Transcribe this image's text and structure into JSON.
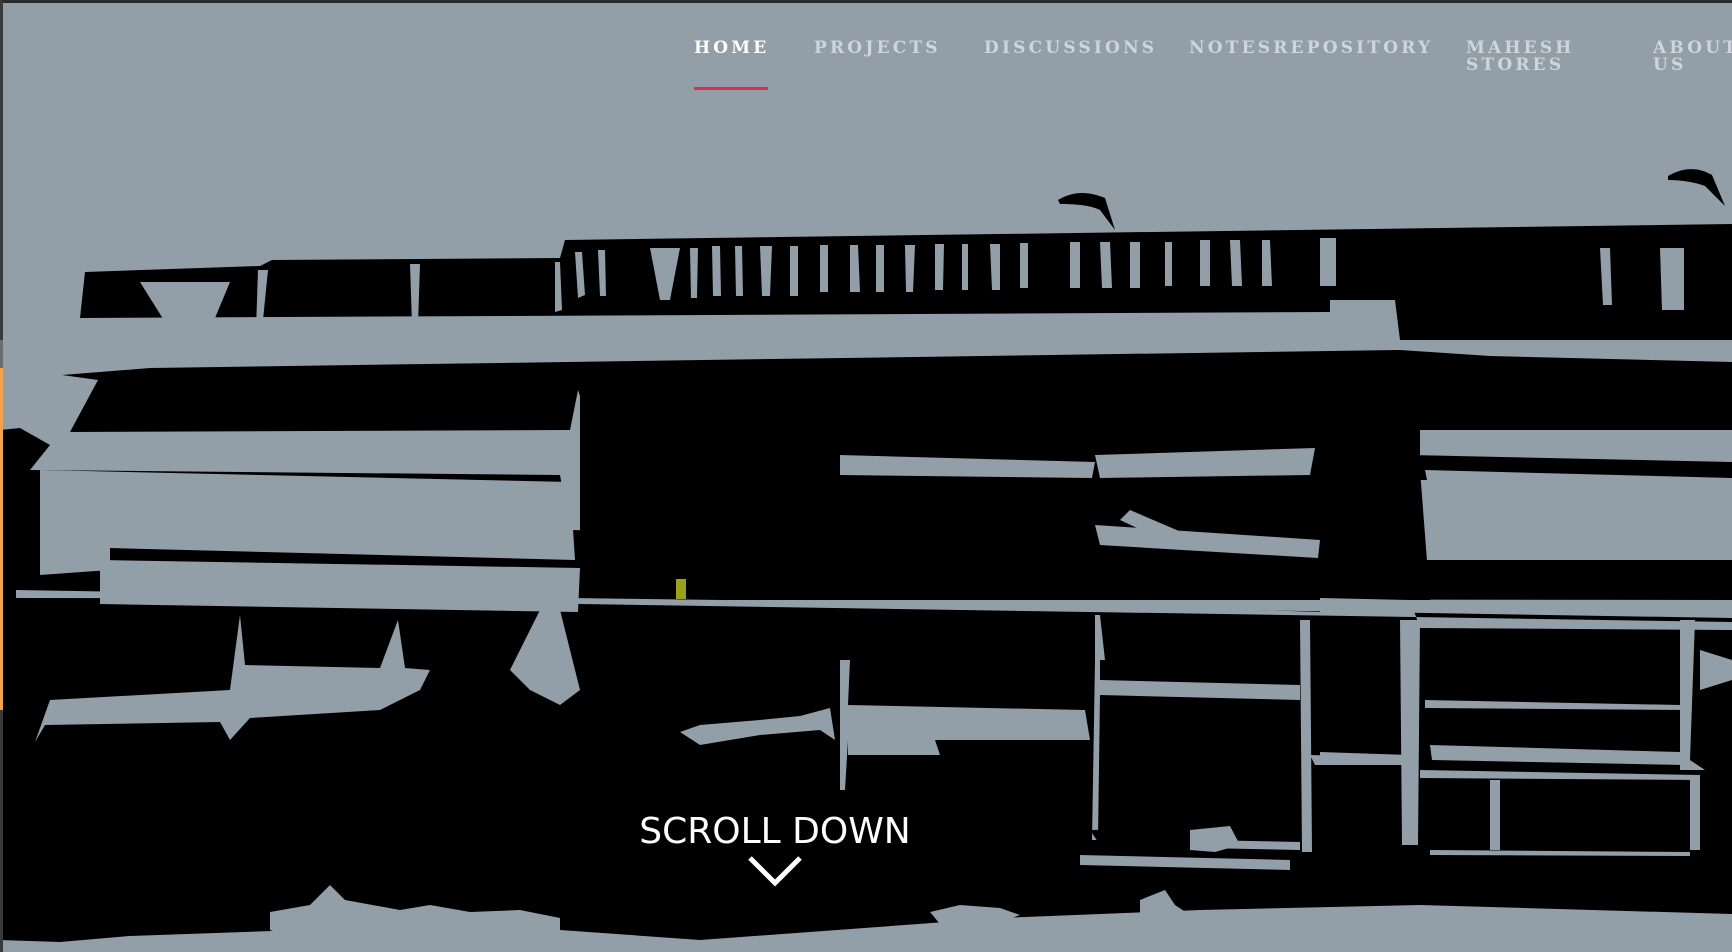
{
  "nav": {
    "items": [
      {
        "label": "HOME",
        "active": true
      },
      {
        "label": "PROJECTS",
        "active": false
      },
      {
        "label": "DISCUSSIONS",
        "active": false
      },
      {
        "label": "NOTESREPOSITORY",
        "active": false
      },
      {
        "label": "MAHESH STORES",
        "active": false
      },
      {
        "label": "ABOUT US",
        "active": false
      }
    ]
  },
  "hero": {
    "scroll_label": "SCROLL DOWN",
    "scroll_icon": "chevron-down-icon"
  },
  "colors": {
    "background": "#929fa9",
    "silhouette": "#000000",
    "nav_text": "#cfd5da",
    "nav_active": "#ffffff",
    "active_underline": "#e02b4c",
    "accent_square": "#9aa21c"
  }
}
